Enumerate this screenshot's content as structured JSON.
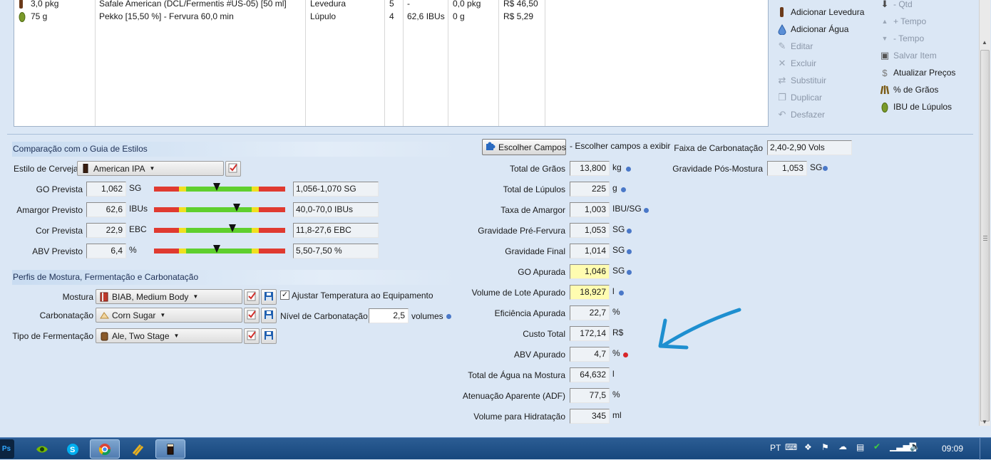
{
  "ingredients": {
    "rows": [
      {
        "amount": "3,0 pkg",
        "name": "Safale American  (DCL/Fermentis #US-05) [50 ml]",
        "type": "Levedura",
        "num": "5",
        "ibu": "-",
        "inventory": "0,0 pkg",
        "cost": "R$ 46,50"
      },
      {
        "amount": "75 g",
        "name": "Pekko [15,50 %] - Fervura 60,0 min",
        "type": "Lúpulo",
        "num": "4",
        "ibu": "62,6 IBUs",
        "inventory": "0 g",
        "cost": "R$ 5,29"
      }
    ]
  },
  "toolbar": {
    "col1": [
      {
        "label": "Adicionar Levedura",
        "icon": "yeast-icon",
        "enabled": true
      },
      {
        "label": "Adicionar Água",
        "icon": "water-drop-icon",
        "enabled": true
      },
      {
        "label": "Editar",
        "icon": "edit-icon",
        "enabled": false
      },
      {
        "label": "Excluir",
        "icon": "delete-icon",
        "enabled": false
      },
      {
        "label": "Substituir",
        "icon": "swap-icon",
        "enabled": false
      },
      {
        "label": "Duplicar",
        "icon": "duplicate-icon",
        "enabled": false
      },
      {
        "label": "Desfazer",
        "icon": "undo-icon",
        "enabled": false
      }
    ],
    "col2": [
      {
        "label": "- Qtd",
        "icon": "arrow-down-icon",
        "enabled": false
      },
      {
        "label": "+ Tempo",
        "icon": "triangle-up-icon",
        "enabled": false
      },
      {
        "label": "- Tempo",
        "icon": "triangle-down-icon",
        "enabled": false
      },
      {
        "label": "Salvar Item",
        "icon": "save-item-icon",
        "enabled": false
      },
      {
        "label": "Atualizar Preços",
        "icon": "dollar-icon",
        "enabled": true
      },
      {
        "label": "% de Grãos",
        "icon": "grain-icon",
        "enabled": true
      },
      {
        "label": "IBU de Lúpulos",
        "icon": "hop-icon",
        "enabled": true
      }
    ]
  },
  "style_guide": {
    "header": "Comparação com o Guia de Estilos",
    "style_label": "Estilo de Cerveja",
    "style_value": "American IPA",
    "rows": [
      {
        "label": "GO Prevista",
        "value": "1,062",
        "unit": "SG",
        "range": "1,056-1,070 SG",
        "marker_fraction": 0.48
      },
      {
        "label": "Amargor Previsto",
        "value": "62,6",
        "unit": "IBUs",
        "range": "40,0-70,0 IBUs",
        "marker_fraction": 0.63
      },
      {
        "label": "Cor Prevista",
        "value": "22,9",
        "unit": "EBC",
        "range": "11,8-27,6 EBC",
        "marker_fraction": 0.6
      },
      {
        "label": "ABV Previsto",
        "value": "6,4",
        "unit": "%",
        "range": "5,50-7,50 %",
        "marker_fraction": 0.48
      }
    ]
  },
  "profiles": {
    "header": "Perfis de Mostura, Fermentação e Carbonatação",
    "mash_label": "Mostura",
    "mash_value": "BIAB, Medium Body",
    "adjust_label": "Ajustar Temperatura ao Equipamento",
    "adjust_checked": true,
    "carb_label": "Carbonatação",
    "carb_value": "Corn Sugar",
    "carb_level_label": "Nível de Carbonatação",
    "carb_level_value": "2,5",
    "carb_level_unit": "volumes",
    "ferm_label": "Tipo de Fermentação",
    "ferm_value": "Ale, Two Stage"
  },
  "fields": {
    "choose_button": "Escolher Campos",
    "choose_hint": "- Escolher campos a exibir",
    "rows": [
      {
        "label": "Total de Grãos",
        "value": "13,800",
        "unit": "kg",
        "dot": "blue",
        "highlight": false
      },
      {
        "label": "Total de Lúpulos",
        "value": "225",
        "unit": "g",
        "dot": "blue",
        "highlight": false
      },
      {
        "label": "Taxa de Amargor",
        "value": "1,003",
        "unit": "IBU/SG",
        "dot": "blue",
        "highlight": false
      },
      {
        "label": "Gravidade Pré-Fervura",
        "value": "1,053",
        "unit": "SG",
        "dot": "blue",
        "highlight": false
      },
      {
        "label": "Gravidade Final",
        "value": "1,014",
        "unit": "SG",
        "dot": "blue",
        "highlight": false
      },
      {
        "label": "GO Apurada",
        "value": "1,046",
        "unit": "SG",
        "dot": "blue",
        "highlight": true
      },
      {
        "label": "Volume de Lote Apurado",
        "value": "18,927",
        "unit": "l",
        "dot": "blue",
        "highlight": true
      },
      {
        "label": "Eficiência Apurada",
        "value": "22,7",
        "unit": "%",
        "dot": "",
        "highlight": false
      },
      {
        "label": "Custo Total",
        "value": "172,14",
        "unit": "R$",
        "dot": "",
        "highlight": false
      },
      {
        "label": "ABV Apurado",
        "value": "4,7",
        "unit": "%",
        "dot": "red",
        "highlight": false
      },
      {
        "label": "Total de Água na Mostura",
        "value": "64,632",
        "unit": "l",
        "dot": "",
        "highlight": false
      },
      {
        "label": "Atenuação Aparente (ADF)",
        "value": "77,5",
        "unit": "%",
        "dot": "",
        "highlight": false
      },
      {
        "label": "Volume para Hidratação",
        "value": "345",
        "unit": "ml",
        "dot": "",
        "highlight": false
      }
    ]
  },
  "carb_info": {
    "range_label": "Faixa de Carbonatação",
    "range_value": "2,40-2,90 Vols",
    "post_mash_label": "Gravidade Pós-Mostura",
    "post_mash_value": "1,053",
    "post_mash_unit": "SG"
  },
  "annotation": {
    "icon": "blue-arrow-annotation",
    "color": "#1e8fd0"
  },
  "taskbar": {
    "apps": [
      "photoshop-icon",
      "nvidia-icon",
      "skype-icon",
      "chrome-icon",
      "brewing-app-icon",
      "beer-glass-icon"
    ],
    "lang": "PT",
    "time": "09:09"
  }
}
